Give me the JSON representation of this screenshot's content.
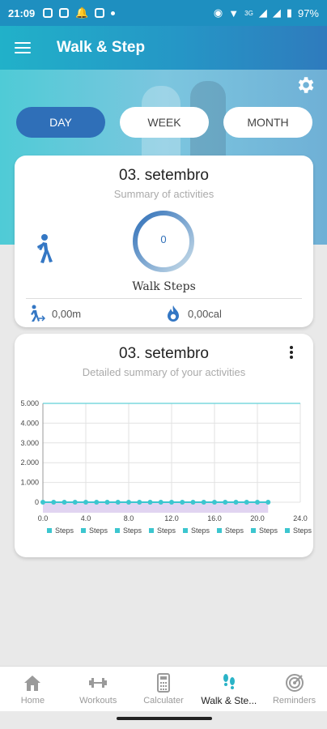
{
  "status_bar": {
    "time": "21:09",
    "network": "3G",
    "battery": "97%"
  },
  "app_bar": {
    "title": "Walk & Step"
  },
  "segments": {
    "day": "DAY",
    "week": "WEEK",
    "month": "MONTH",
    "active": "day"
  },
  "summary_card": {
    "date": "03. setembro",
    "subtitle": "Summary of activities",
    "steps_value": "0",
    "steps_label": "Walk Steps",
    "distance": "0,00m",
    "calories": "0,00cal"
  },
  "detail_card": {
    "date": "03. setembro",
    "subtitle": "Detailed summary of your activities"
  },
  "chart_data": {
    "type": "line",
    "x": [
      0,
      1,
      2,
      3,
      4,
      5,
      6,
      7,
      8,
      9,
      10,
      11,
      12,
      13,
      14,
      15,
      16,
      17,
      18,
      19,
      20,
      21
    ],
    "series": [
      {
        "name": "Steps",
        "values": [
          0,
          0,
          0,
          0,
          0,
          0,
          0,
          0,
          0,
          0,
          0,
          0,
          0,
          0,
          0,
          0,
          0,
          0,
          0,
          0,
          0,
          0
        ]
      }
    ],
    "reference_line": 5000,
    "xlim": [
      0,
      24
    ],
    "ylim": [
      0,
      5000
    ],
    "x_ticks": [
      "0.0",
      "4.0",
      "8.0",
      "12.0",
      "16.0",
      "20.0",
      "24.0"
    ],
    "y_ticks": [
      "0",
      "1.000",
      "2.000",
      "3.000",
      "4.000",
      "5.000"
    ],
    "legend": [
      "Steps",
      "Steps",
      "Steps",
      "Steps",
      "Steps",
      "Steps",
      "Steps",
      "Steps"
    ],
    "grid": true,
    "colors": {
      "line": "#3cc6cf",
      "fill": "#d9c9ee",
      "reference": "#5fd0d6"
    }
  },
  "bottom_nav": [
    {
      "label": "Home",
      "icon": "home-icon"
    },
    {
      "label": "Workouts",
      "icon": "dumbbell-icon"
    },
    {
      "label": "Calculater",
      "icon": "calculator-icon"
    },
    {
      "label": "Walk & Ste...",
      "icon": "footsteps-icon",
      "active": true
    },
    {
      "label": "Reminders",
      "icon": "target-icon"
    }
  ],
  "colors": {
    "primary": "#2f6fb8",
    "accent": "#21b1c9"
  }
}
